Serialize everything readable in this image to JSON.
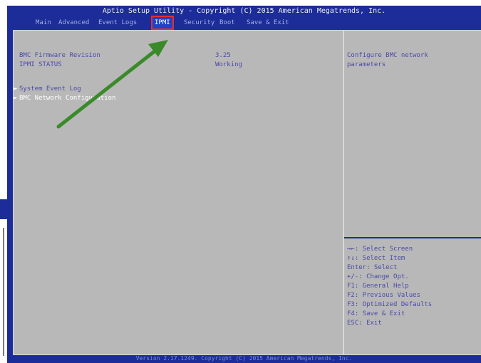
{
  "header": {
    "title": "Aptio Setup Utility - Copyright (C) 2015 American Megatrends, Inc.",
    "tabs": [
      {
        "label": "Main"
      },
      {
        "label": "Advanced"
      },
      {
        "label": "Event Logs"
      },
      {
        "label": "IPMI"
      },
      {
        "label": "Security"
      },
      {
        "label": "Boot"
      },
      {
        "label": "Save & Exit"
      }
    ],
    "active_tab": "IPMI"
  },
  "main": {
    "info": [
      {
        "label": "BMC Firmware Revision",
        "value": "3.25"
      },
      {
        "label": "IPMI STATUS",
        "value": "Working"
      }
    ],
    "menu": [
      {
        "label": "System Event Log"
      },
      {
        "label": "BMC Network Configuration"
      }
    ]
  },
  "help": {
    "description": [
      "Configure BMC network",
      "parameters"
    ],
    "keys": [
      "→←: Select Screen",
      "↑↓: Select Item",
      "Enter: Select",
      "+/-: Change Opt.",
      "F1: General Help",
      "F2: Previous Values",
      "F3: Optimized Defaults",
      "F4: Save & Exit",
      "ESC: Exit"
    ]
  },
  "footer": {
    "text": "Version 2.17.1249. Copyright (C) 2015 American Megatrends, Inc."
  },
  "colors": {
    "background": "#1c2c98",
    "panel": "#b8b8b8",
    "highlight_box": "#e03030",
    "annotation_arrow": "#3a8a2a"
  }
}
